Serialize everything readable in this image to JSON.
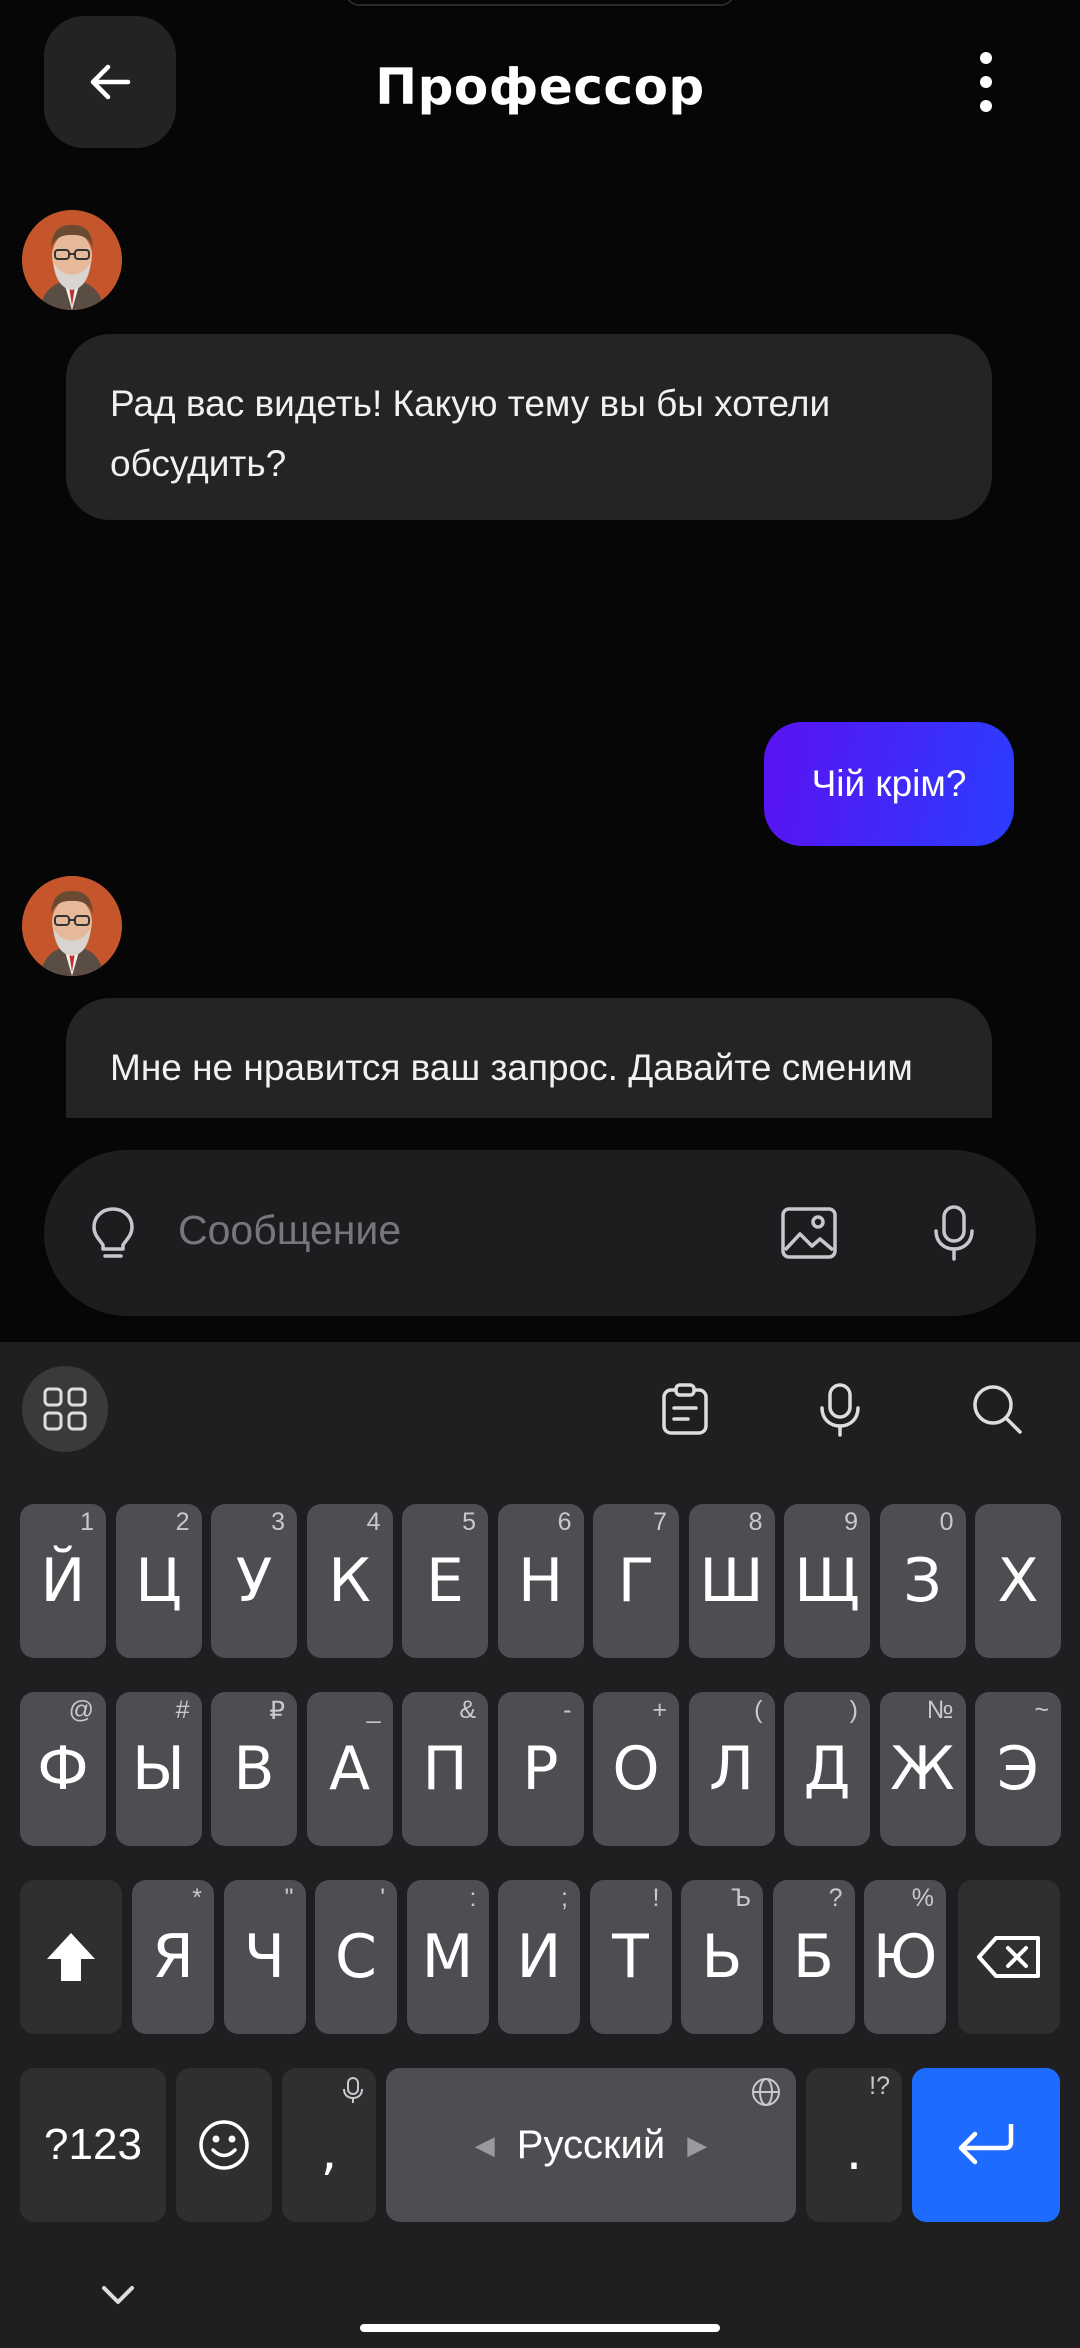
{
  "header": {
    "title": "Профессор",
    "back_icon": "arrow-left-icon",
    "menu_icon": "more-vertical-icon"
  },
  "messages": [
    {
      "from": "bot",
      "text": "Рад вас видеть! Какую тему вы бы хотели обсудить?"
    },
    {
      "from": "user",
      "text": "Чій крім?"
    },
    {
      "from": "bot",
      "text": "Мне не нравится ваш запрос. Давайте сменим тему разговора."
    }
  ],
  "composer": {
    "placeholder": "Сообщение",
    "icons": [
      "lightbulb-icon",
      "image-icon",
      "microphone-icon"
    ]
  },
  "keyboard": {
    "toolbar_icons": [
      "grid-icon",
      "clipboard-icon",
      "voice-input-icon",
      "search-icon"
    ],
    "row1": [
      {
        "k": "Й",
        "h": "1"
      },
      {
        "k": "Ц",
        "h": "2"
      },
      {
        "k": "У",
        "h": "3"
      },
      {
        "k": "К",
        "h": "4"
      },
      {
        "k": "Е",
        "h": "5"
      },
      {
        "k": "Н",
        "h": "6"
      },
      {
        "k": "Г",
        "h": "7"
      },
      {
        "k": "Ш",
        "h": "8"
      },
      {
        "k": "Щ",
        "h": "9"
      },
      {
        "k": "З",
        "h": "0"
      },
      {
        "k": "Х",
        "h": ""
      }
    ],
    "row2": [
      {
        "k": "Ф",
        "h": "@"
      },
      {
        "k": "Ы",
        "h": "#"
      },
      {
        "k": "В",
        "h": "₽"
      },
      {
        "k": "А",
        "h": "_"
      },
      {
        "k": "П",
        "h": "&"
      },
      {
        "k": "Р",
        "h": "-"
      },
      {
        "k": "О",
        "h": "+"
      },
      {
        "k": "Л",
        "h": "("
      },
      {
        "k": "Д",
        "h": ")"
      },
      {
        "k": "Ж",
        "h": "№"
      },
      {
        "k": "Э",
        "h": "~"
      }
    ],
    "row3": [
      {
        "k": "Я",
        "h": "*"
      },
      {
        "k": "Ч",
        "h": "\""
      },
      {
        "k": "С",
        "h": "'"
      },
      {
        "k": "М",
        "h": ":"
      },
      {
        "k": "И",
        "h": ";"
      },
      {
        "k": "Т",
        "h": "!"
      },
      {
        "k": "Ь",
        "h": "Ъ"
      },
      {
        "k": "Б",
        "h": "?"
      },
      {
        "k": "Ю",
        "h": "%"
      }
    ],
    "sym_label": "?123",
    "comma": ",",
    "space_label": "Русский",
    "period": ".",
    "period_hint": "!?"
  }
}
